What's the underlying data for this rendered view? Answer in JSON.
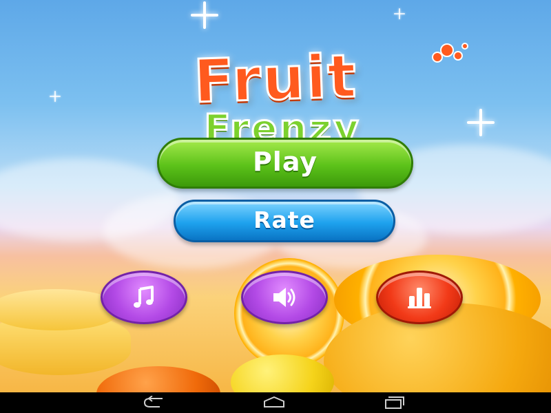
{
  "game": {
    "title_line1": "Fruit",
    "title_line2": "Frenzy"
  },
  "menu": {
    "play_label": "Play",
    "rate_label": "Rate"
  },
  "icon_buttons": [
    {
      "name": "music",
      "icon": "music-note-icon"
    },
    {
      "name": "sound",
      "icon": "speaker-icon"
    },
    {
      "name": "leaderboard",
      "icon": "bar-chart-icon"
    }
  ],
  "navbar": {
    "buttons": [
      "back-icon",
      "home-icon",
      "recent-apps-icon"
    ]
  },
  "colors": {
    "title_fruit": "#ff5a1e",
    "title_frenzy": "#7cd12e",
    "play_button": "#5cc21a",
    "rate_button": "#1ea2ee",
    "music_button": "#b34ae6",
    "sound_button": "#b34ae6",
    "leaderboard_button": "#f23a18"
  }
}
